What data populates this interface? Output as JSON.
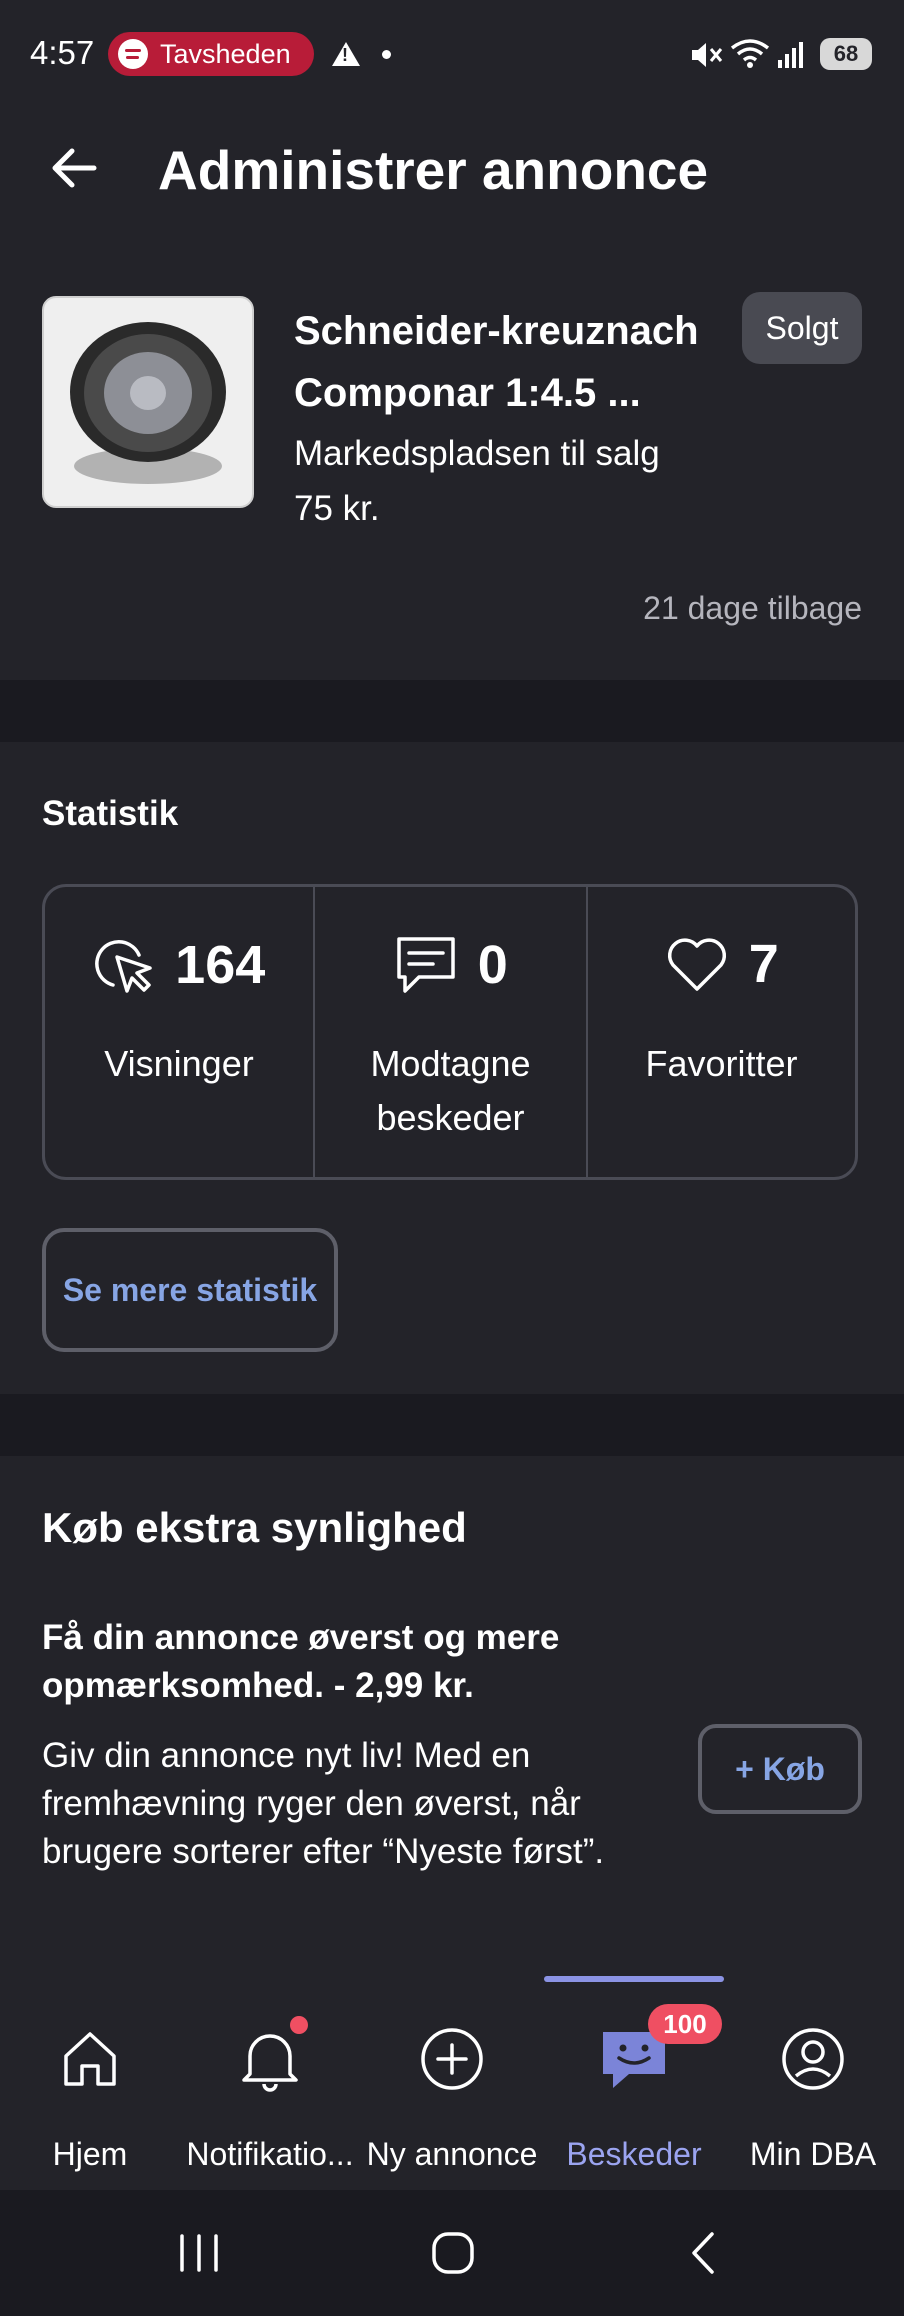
{
  "status_bar": {
    "time": "4:57",
    "spotify_label": "Tavsheden",
    "battery": "68"
  },
  "header": {
    "title": "Administrer annonce"
  },
  "listing": {
    "title": "Schneider-kreuznach Componar 1:4.5 ...",
    "subtitle": "Markedspladsen til salg 75 kr.",
    "status_badge": "Solgt",
    "date": "21 dage tilbage"
  },
  "statistics": {
    "heading": "Statistik",
    "items": [
      {
        "icon": "cursor-click-icon",
        "value": "164",
        "label": "Visninger"
      },
      {
        "icon": "message-icon",
        "value": "0",
        "label": "Modtagne beskeder"
      },
      {
        "icon": "heart-icon",
        "value": "7",
        "label": "Favoritter"
      }
    ],
    "more_button": "Se mere statistik"
  },
  "visibility": {
    "heading": "Køb ekstra synlighed",
    "offer": "Få din annonce øverst og mere opmærksomhed. - 2,99 kr.",
    "description": "Giv din annonce nyt liv! Med en fremhævning ryger den øverst, når brugere sorterer efter “Nyeste først”.",
    "buy_button": "+ Køb"
  },
  "bottom_nav": {
    "items": [
      {
        "icon": "home-icon",
        "label": "Hjem"
      },
      {
        "icon": "bell-icon",
        "label": "Notifikatio..."
      },
      {
        "icon": "plus-circle-icon",
        "label": "Ny annonce"
      },
      {
        "icon": "chat-icon",
        "label": "Beskeder",
        "badge": "100",
        "active": true
      },
      {
        "icon": "profile-icon",
        "label": "Min DBA"
      }
    ]
  },
  "colors": {
    "background": "#232329",
    "band": "#1a1a20",
    "accent": "#87a5e4",
    "active_nav": "#9ba4f0",
    "badge": "#ef4f62",
    "spotify_pill": "#b81c38"
  }
}
